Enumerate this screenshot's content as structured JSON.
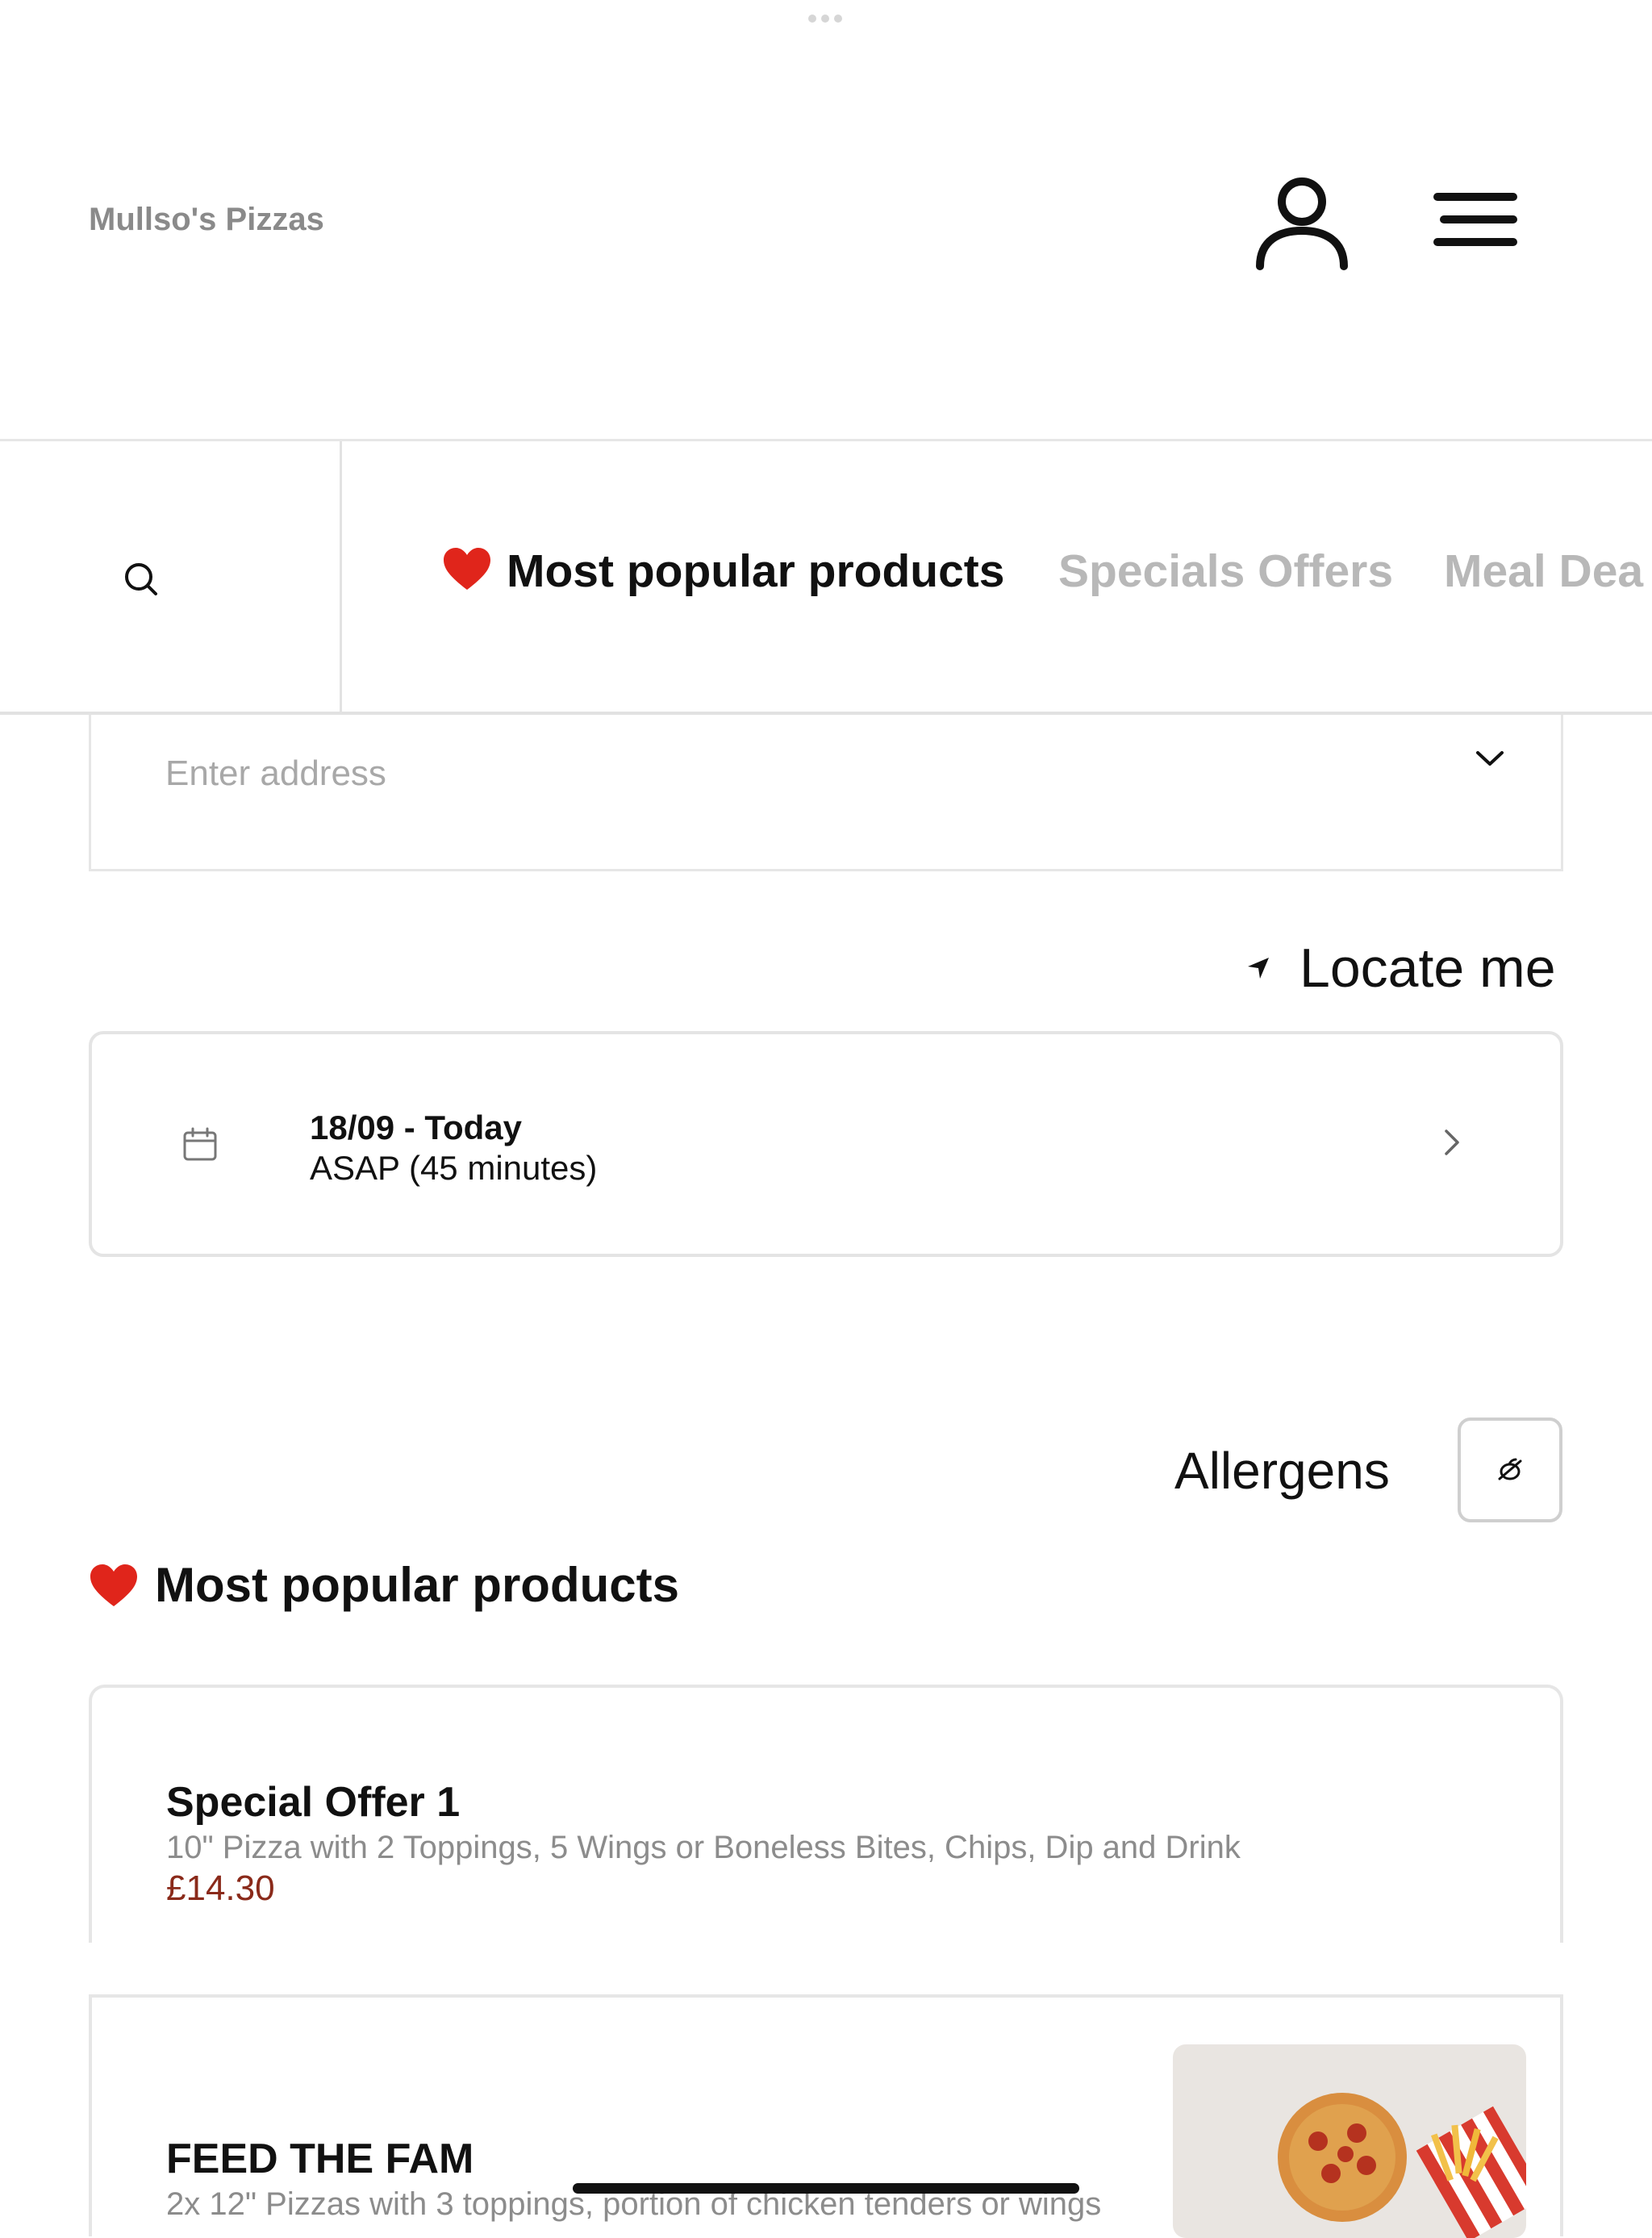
{
  "header": {
    "brand": "Mullso's Pizzas"
  },
  "categories": {
    "tabs": [
      {
        "label": "Most popular products",
        "icon": "heart-icon"
      },
      {
        "label": "Specials Offers"
      },
      {
        "label": "Meal Dea"
      }
    ]
  },
  "address": {
    "placeholder": "Enter address"
  },
  "locate": {
    "label": "Locate me"
  },
  "delivery_time": {
    "date": "18/09 - Today",
    "time": "ASAP (45 minutes)"
  },
  "allergens": {
    "label": "Allergens"
  },
  "section": {
    "title": "Most popular products"
  },
  "products": [
    {
      "name": "Special Offer 1",
      "description": "10\" Pizza with 2 Toppings, 5 Wings or Boneless Bites, Chips, Dip and Drink",
      "price": "£14.30"
    },
    {
      "name": "FEED THE FAM",
      "description": "2x 12\" Pizzas with 3 toppings, portion of chicken tenders or wings"
    }
  ],
  "colors": {
    "price": "#8a2a1a",
    "heart": "#e0251b",
    "inactive_tab": "#b8b8b8"
  }
}
